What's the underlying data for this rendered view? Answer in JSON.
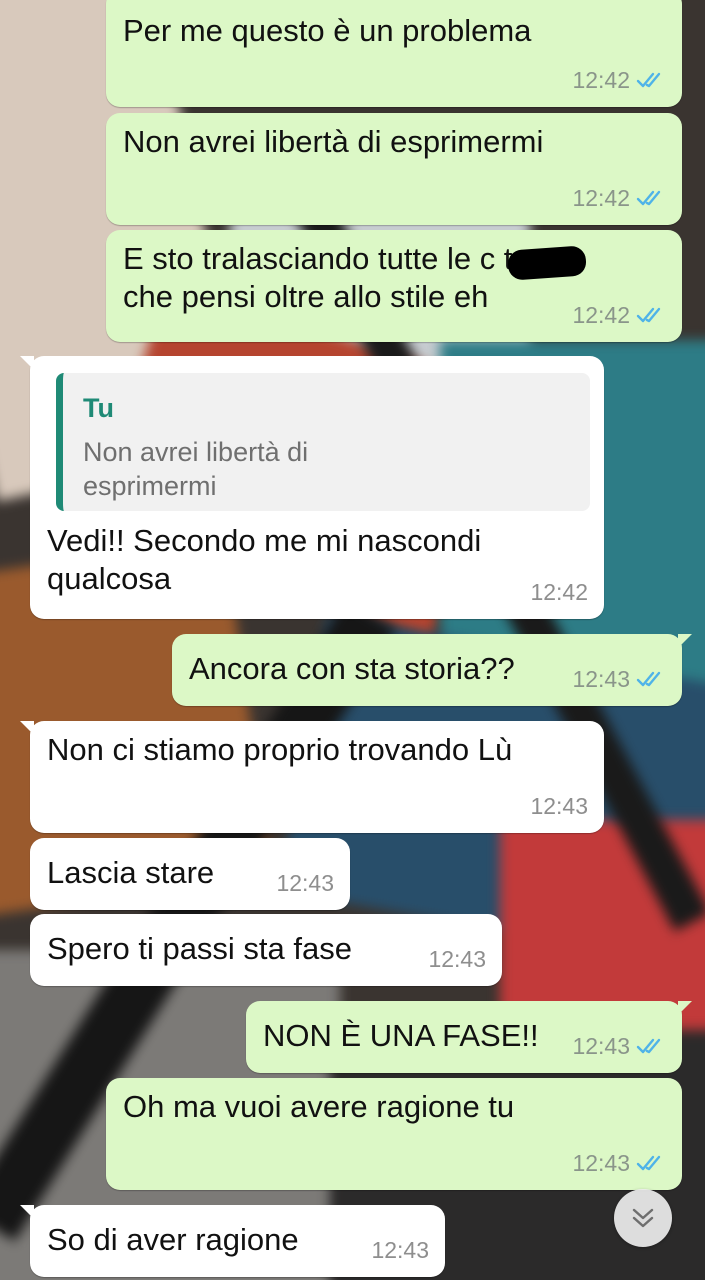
{
  "messages": [
    {
      "dir": "out",
      "text": "Per me questo è un problema",
      "time": "12:42",
      "read": true
    },
    {
      "dir": "out",
      "text": "Non avrei libertà di esprimermi",
      "time": "12:42",
      "read": true
    },
    {
      "dir": "out",
      "text": "E sto tralasciando tutte le c        te\nche pensi oltre allo stile eh",
      "time": "12:42",
      "read": true,
      "redacted": true
    },
    {
      "dir": "in",
      "reply_to": {
        "name": "Tu",
        "text": "Non avrei libertà di\nesprimermi"
      },
      "text": "Vedi!! Secondo me mi nascondi\nqualcosa",
      "time": "12:42"
    },
    {
      "dir": "out",
      "text": "Ancora con sta storia??",
      "time": "12:43",
      "read": true
    },
    {
      "dir": "in",
      "text": "Non ci stiamo proprio trovando Lù",
      "time": "12:43"
    },
    {
      "dir": "in",
      "text": "Lascia stare",
      "time": "12:43"
    },
    {
      "dir": "in",
      "text": "Spero ti passi sta fase",
      "time": "12:43"
    },
    {
      "dir": "out",
      "text": "NON È UNA FASE!!",
      "time": "12:43",
      "read": true
    },
    {
      "dir": "out",
      "text": "Oh ma vuoi avere ragione tu",
      "time": "12:43",
      "read": true
    },
    {
      "dir": "in",
      "text": "So di aver ragione",
      "time": "12:43"
    }
  ],
  "colors": {
    "outgoing_bubble": "#dcf8c6",
    "incoming_bubble": "#ffffff",
    "read_ticks": "#4fb3e8",
    "reply_accent": "#1f8a76"
  },
  "icons": {
    "read_receipt": "double-check-icon",
    "scroll_down": "chevron-down-icon"
  }
}
